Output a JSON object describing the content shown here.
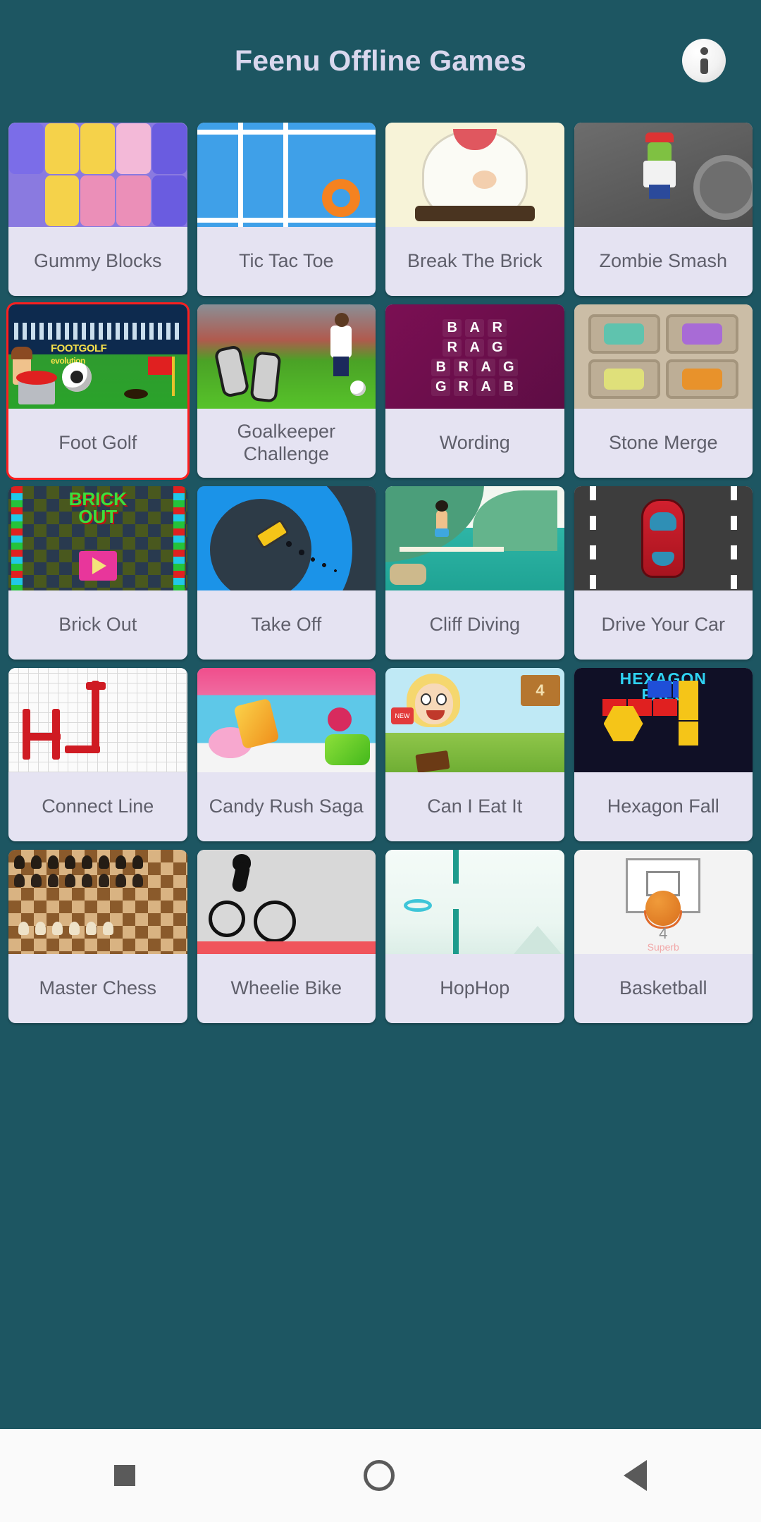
{
  "header": {
    "title": "Feenu Offline Games",
    "info_icon": "info-icon"
  },
  "nav": {
    "recents_label": "square",
    "home_label": "circle",
    "back_label": "triangle"
  },
  "games": [
    {
      "title": "Gummy Blocks",
      "art": "gummy",
      "highlight": false
    },
    {
      "title": "Tic Tac Toe",
      "art": "ttt",
      "highlight": false
    },
    {
      "title": "Break The Brick",
      "art": "brick",
      "highlight": false
    },
    {
      "title": "Zombie Smash",
      "art": "zombie",
      "highlight": false
    },
    {
      "title": "Foot Golf",
      "art": "footgolf",
      "highlight": true
    },
    {
      "title": "Goalkeeper Challenge",
      "art": "keeper",
      "highlight": false
    },
    {
      "title": "Wording",
      "art": "wording",
      "highlight": false
    },
    {
      "title": "Stone Merge",
      "art": "stone",
      "highlight": false
    },
    {
      "title": "Brick Out",
      "art": "brickout",
      "highlight": false
    },
    {
      "title": "Take Off",
      "art": "takeoff",
      "highlight": false
    },
    {
      "title": "Cliff Diving",
      "art": "cliff",
      "highlight": false
    },
    {
      "title": "Drive Your Car",
      "art": "drive",
      "highlight": false
    },
    {
      "title": "Connect Line",
      "art": "connect",
      "highlight": false
    },
    {
      "title": "Candy Rush Saga",
      "art": "candy",
      "highlight": false
    },
    {
      "title": "Can I Eat It",
      "art": "eat",
      "highlight": false
    },
    {
      "title": "Hexagon Fall",
      "art": "hex",
      "highlight": false
    },
    {
      "title": "Master Chess",
      "art": "chess",
      "highlight": false
    },
    {
      "title": "Wheelie Bike",
      "art": "wheelie",
      "highlight": false
    },
    {
      "title": "HopHop",
      "art": "hop",
      "highlight": false
    },
    {
      "title": "Basketball",
      "art": "ball",
      "highlight": false
    }
  ],
  "artwork_text": {
    "footgolf_logo": "FOOTGOLF",
    "footgolf_sub": "evolution",
    "wording_rows": [
      "BAR",
      "RAG",
      "BRAG",
      "GRAB"
    ],
    "brickout_line1": "BRICK",
    "brickout_line2": "OUT",
    "hexagon_line1": "HEXAGON",
    "hexagon_line2": "FALL",
    "can_i_eat_it_sign": "4",
    "can_i_eat_it_badge": "NEW",
    "basketball_score": "4",
    "basketball_superb": "Superb"
  },
  "colors": {
    "background": "#1d5662",
    "card_label_bg": "#e5e3f2",
    "label_text": "#5f5f6b",
    "title_text": "#d9d7ee",
    "highlight_border": "#ff1f1f",
    "navbar_bg": "#fafafa"
  }
}
